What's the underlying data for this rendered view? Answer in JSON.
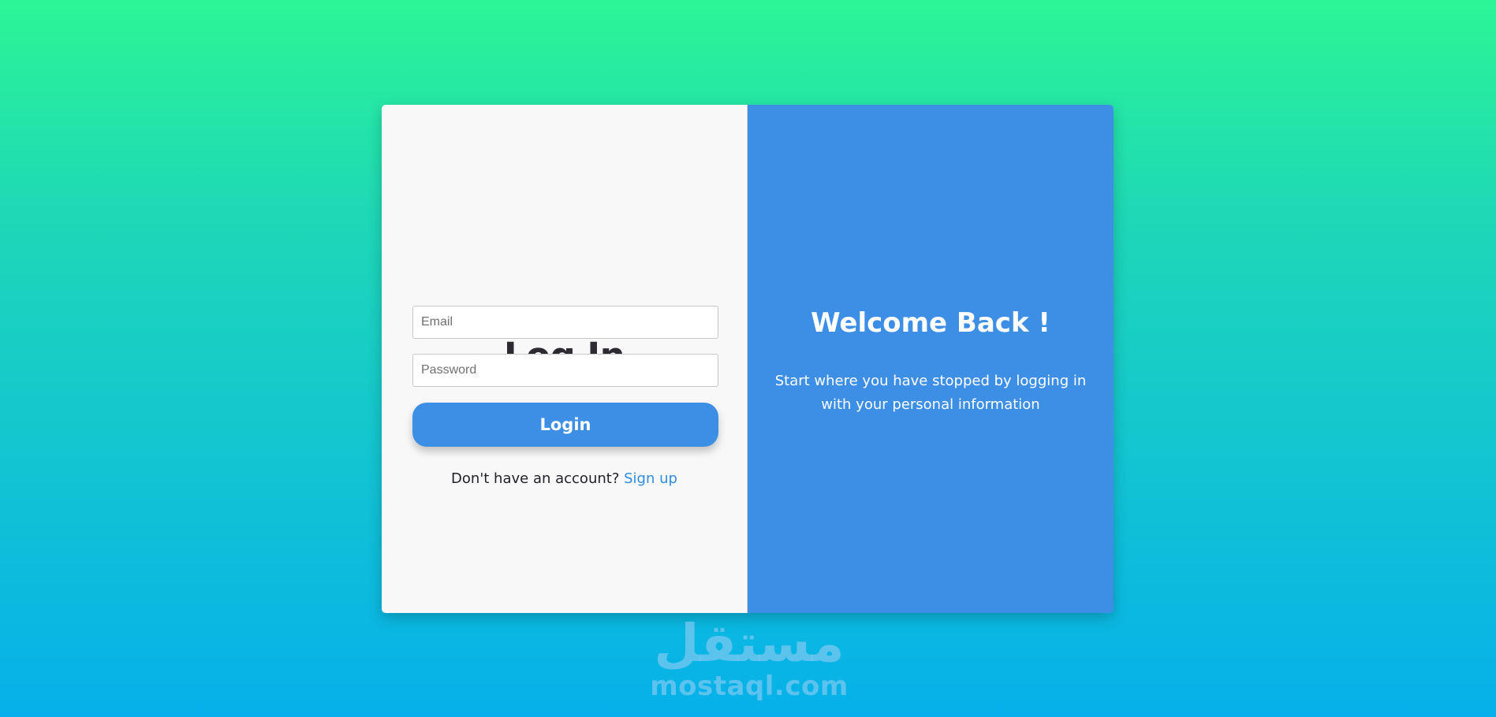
{
  "login": {
    "title": "Log In",
    "email_placeholder": "Email",
    "password_placeholder": "Password",
    "button_label": "Login",
    "signup_prompt": "Don't have an account?",
    "signup_link": "Sign up"
  },
  "welcome": {
    "title": "Welcome Back !",
    "text": "Start where you have stopped by logging in with your personal information"
  },
  "watermark": {
    "arabic": "مستقل",
    "latin": "mostaql.com"
  },
  "colors": {
    "accent": "#3d8fe6",
    "link": "#2f8ce0",
    "background_top": "#2cf596",
    "background_bottom": "#06b0ea",
    "panel": "#f8f8f8",
    "title_text": "#2d2a32"
  }
}
